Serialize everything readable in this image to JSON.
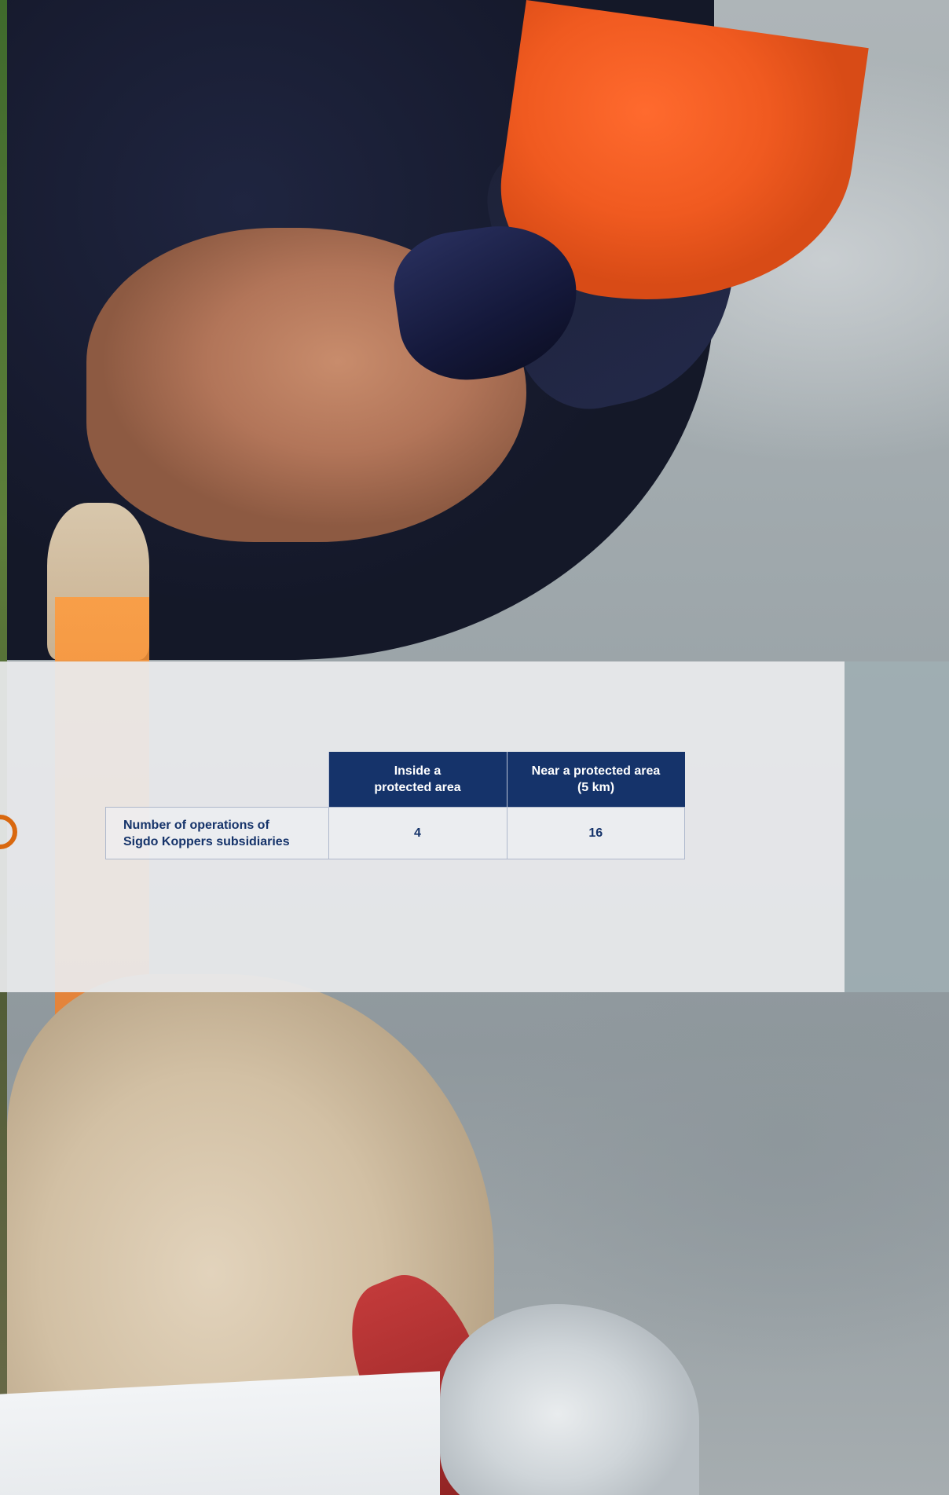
{
  "table": {
    "headers": {
      "inside": [
        "Inside a",
        "protected area"
      ],
      "near": [
        "Near a protected area",
        "(5 km)"
      ]
    },
    "row": {
      "label": [
        "Number of operations of",
        "Sigdo Koppers subsidiaries"
      ],
      "inside_value": "4",
      "near_value": "16"
    }
  },
  "colors": {
    "header_bg": "#15336a",
    "text_primary": "#15336a",
    "panel_bg": "#e9ebed",
    "accent_orange": "#d9680f"
  },
  "photo": {
    "subject": "worker-with-orange-helmet-and-sunglasses"
  }
}
